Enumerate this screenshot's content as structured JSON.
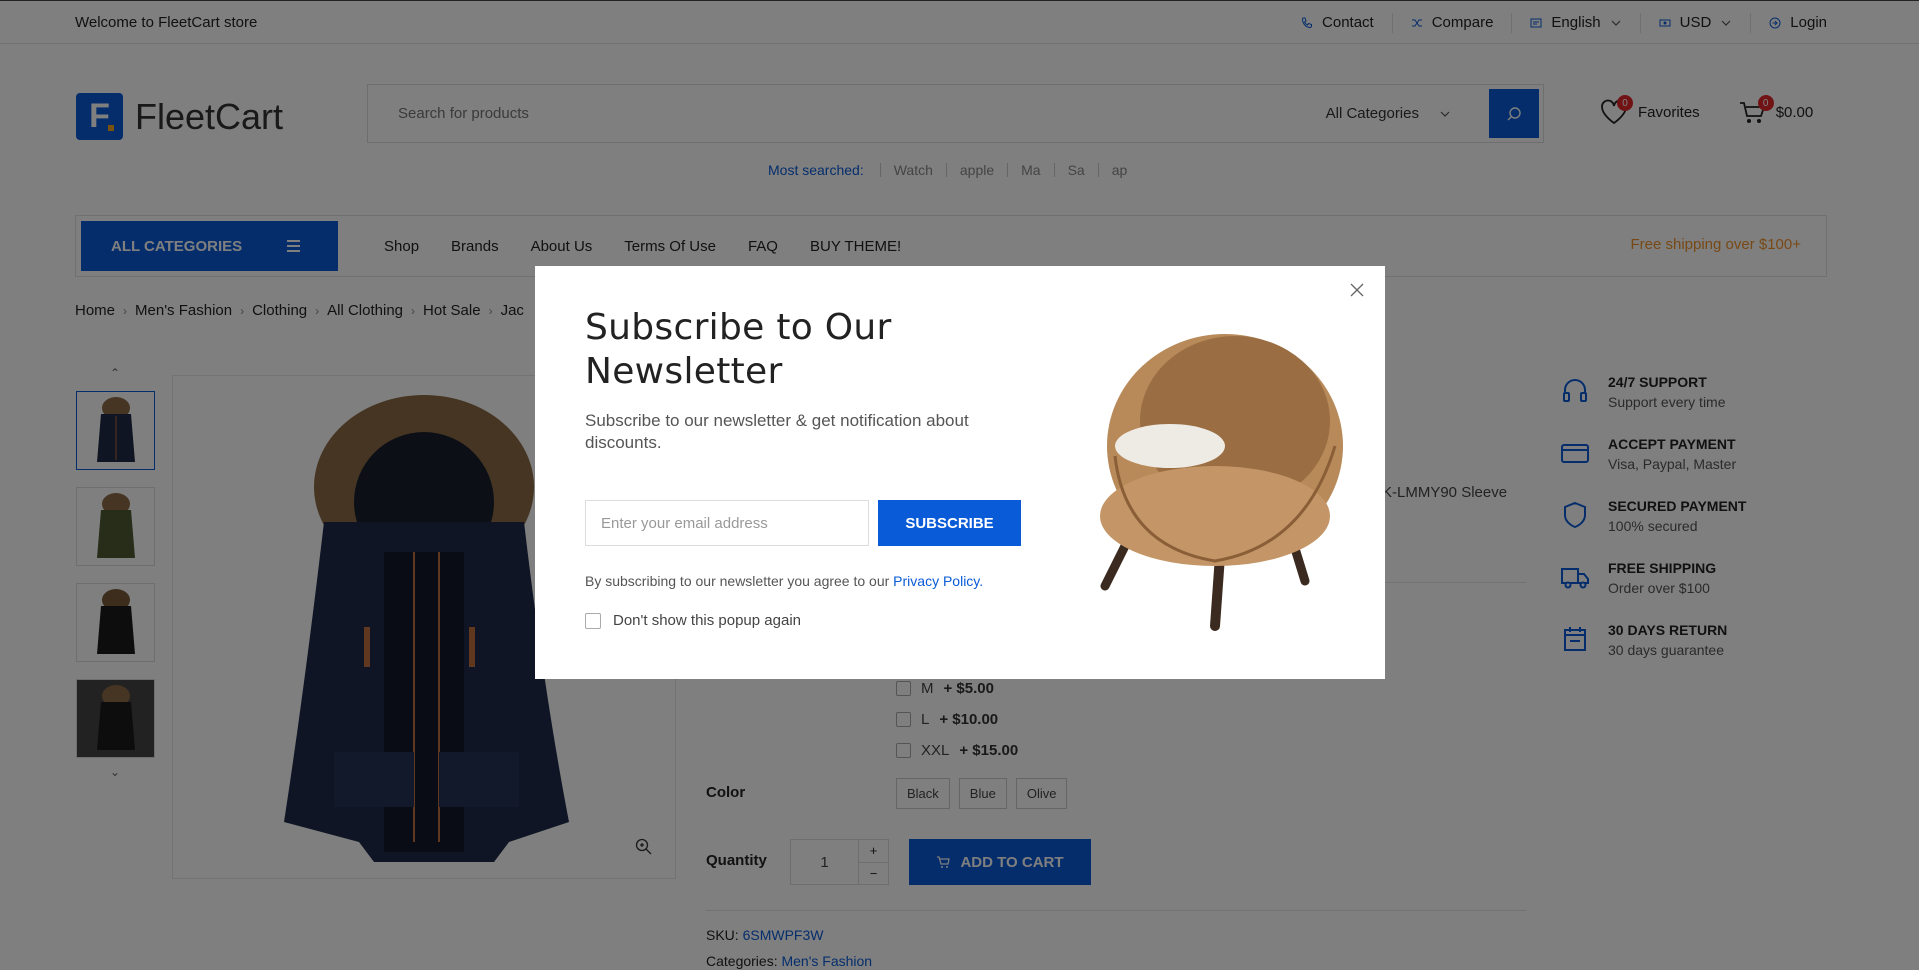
{
  "topbar": {
    "welcome": "Welcome to FleetCart store",
    "links": {
      "contact": "Contact",
      "compare": "Compare",
      "language": "English",
      "currency": "USD",
      "login": "Login"
    }
  },
  "header": {
    "logo_text": "FleetCart",
    "search_placeholder": "Search for products",
    "category_select": "All Categories",
    "favorites_label": "Favorites",
    "favorites_count": "0",
    "cart_total": "$0.00",
    "cart_count": "0",
    "most_searched_label": "Most searched:",
    "most_searched": [
      "Watch",
      "apple",
      "Ma",
      "Sa",
      "ap"
    ]
  },
  "nav": {
    "all_categories": "ALL CATEGORIES",
    "menu": [
      "Shop",
      "Brands",
      "About Us",
      "Terms Of Use",
      "FAQ",
      "BUY THEME!"
    ],
    "free_shipping": "Free shipping over $100+"
  },
  "breadcrumb": [
    "Home",
    "Men's Fashion",
    "Clothing",
    "All Clothing",
    "Hot Sale",
    "Jac"
  ],
  "product": {
    "desc_fragment": "K-LMMY90 Sleeve",
    "size_options": [
      {
        "name": "M",
        "price": "+ $5.00"
      },
      {
        "name": "L",
        "price": "+ $10.00"
      },
      {
        "name": "XXL",
        "price": "+ $15.00"
      }
    ],
    "color_label": "Color",
    "colors": [
      "Black",
      "Blue",
      "Olive"
    ],
    "quantity_label": "Quantity",
    "quantity": "1",
    "add_to_cart": "ADD TO CART",
    "sku_label": "SKU:",
    "sku": "6SMWPF3W",
    "categories_label": "Categories:",
    "category": "Men's Fashion"
  },
  "features": [
    {
      "title": "24/7 SUPPORT",
      "sub": "Support every time",
      "icon": "headphones-icon"
    },
    {
      "title": "ACCEPT PAYMENT",
      "sub": "Visa, Paypal, Master",
      "icon": "credit-card-icon"
    },
    {
      "title": "SECURED PAYMENT",
      "sub": "100% secured",
      "icon": "shield-icon"
    },
    {
      "title": "FREE SHIPPING",
      "sub": "Order over $100",
      "icon": "truck-icon"
    },
    {
      "title": "30 DAYS RETURN",
      "sub": "30 days guarantee",
      "icon": "calendar-icon"
    }
  ],
  "modal": {
    "title": "Subscribe to Our Newsletter",
    "subtitle": "Subscribe to our newsletter & get notification about discounts.",
    "email_placeholder": "Enter your email address",
    "subscribe_button": "SUBSCRIBE",
    "agree_text": "By subscribing to our newsletter you agree to our",
    "privacy_link": "Privacy Policy.",
    "dont_show": "Don't show this popup again"
  },
  "colors": {
    "accent": "#0a5bd8",
    "free_shipping": "#f0932b",
    "badge": "#e3262b"
  }
}
